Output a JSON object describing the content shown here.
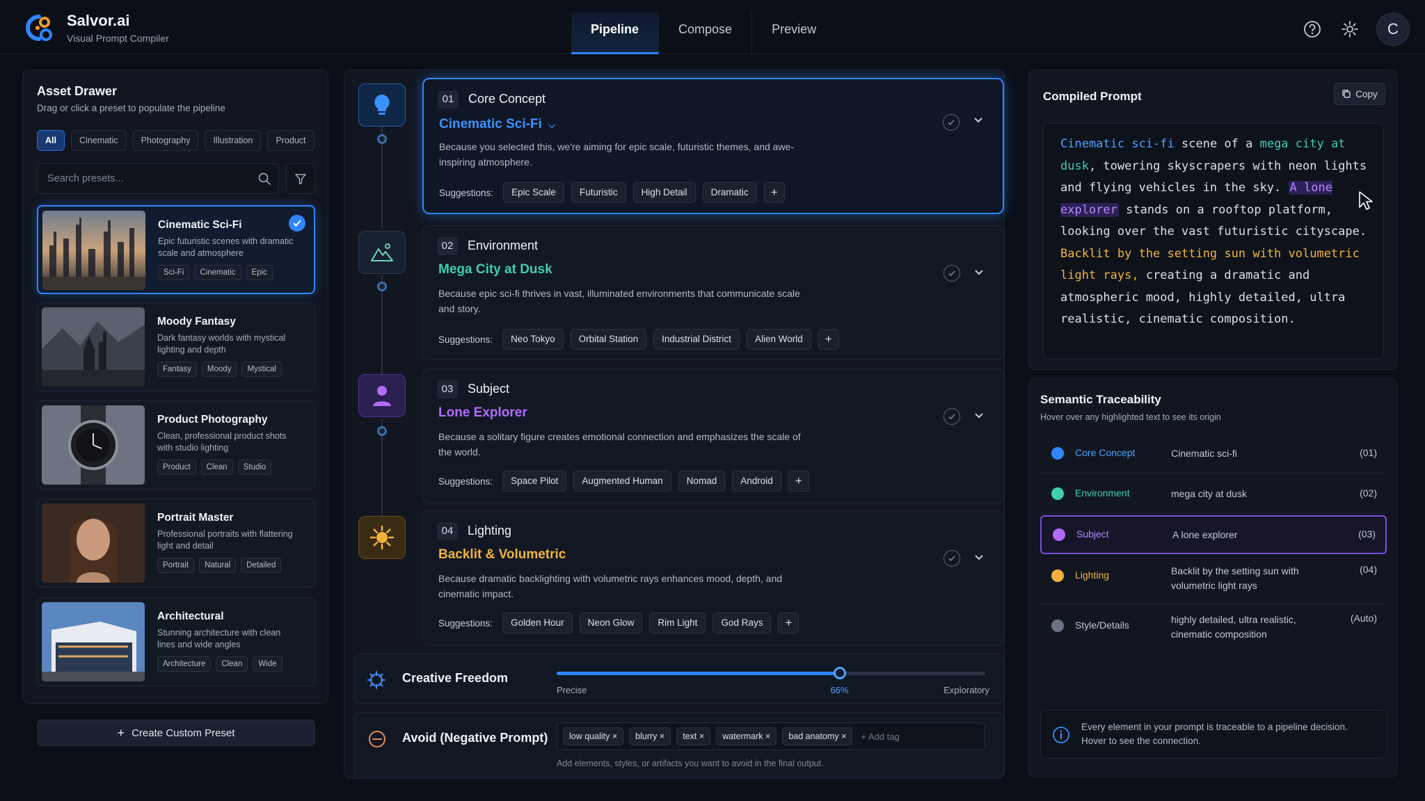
{
  "app": {
    "name": "Salvor.ai",
    "subtitle": "Visual Prompt Compiler",
    "avatar_initial": "C"
  },
  "nav": {
    "tabs": [
      {
        "label": "Pipeline",
        "active": true
      },
      {
        "label": "Compose"
      },
      {
        "label": "Preview"
      }
    ]
  },
  "header_icons": [
    "help-icon",
    "gear-icon"
  ],
  "drawer": {
    "title": "Asset Drawer",
    "subtitle": "Drag or click a preset to populate the pipeline",
    "filters": [
      "All",
      "Cinematic",
      "Photography",
      "Illustration",
      "Product"
    ],
    "search_placeholder": "Search presets...",
    "presets": [
      {
        "name": "Cinematic Sci-Fi",
        "desc": "Epic futuristic scenes with dramatic scale and atmosphere",
        "tags": [
          "Sci-Fi",
          "Cinematic",
          "Epic"
        ],
        "selected": true
      },
      {
        "name": "Moody Fantasy",
        "desc": "Dark fantasy worlds with mystical lighting and depth",
        "tags": [
          "Fantasy",
          "Moody",
          "Mystical"
        ]
      },
      {
        "name": "Product Photography",
        "desc": "Clean, professional product shots with studio lighting",
        "tags": [
          "Product",
          "Clean",
          "Studio"
        ]
      },
      {
        "name": "Portrait Master",
        "desc": "Professional portraits with flattering light and detail",
        "tags": [
          "Portrait",
          "Natural",
          "Detailed"
        ]
      },
      {
        "name": "Architectural",
        "desc": "Stunning architecture with clean lines and wide angles",
        "tags": [
          "Architecture",
          "Clean",
          "Wide"
        ]
      }
    ],
    "create_label": "Create Custom Preset"
  },
  "pipeline": {
    "suggestions_label": "Suggestions:",
    "steps": [
      {
        "num": "01",
        "label": "Core Concept",
        "value": "Cinematic Sci-Fi",
        "color": "#2f86ff",
        "because": "Because you selected this, we're aiming for epic scale, futuristic themes, and awe-inspiring atmosphere.",
        "suggestions": [
          "Epic Scale",
          "Futuristic",
          "High Detail",
          "Dramatic"
        ],
        "icon": "lightbulb-icon"
      },
      {
        "num": "02",
        "label": "Environment",
        "value": "Mega City at Dusk",
        "color": "#3fcfae",
        "because": "Because epic sci-fi thrives in vast, illuminated environments that communicate scale and story.",
        "suggestions": [
          "Neo Tokyo",
          "Orbital Station",
          "Industrial District",
          "Alien World"
        ],
        "icon": "mountain-icon"
      },
      {
        "num": "03",
        "label": "Subject",
        "value": "Lone Explorer",
        "color": "#b26bff",
        "because": "Because a solitary figure creates emotional connection and emphasizes the scale of the world.",
        "suggestions": [
          "Space Pilot",
          "Augmented Human",
          "Nomad",
          "Android"
        ],
        "icon": "person-icon"
      },
      {
        "num": "04",
        "label": "Lighting",
        "value": "Backlit & Volumetric",
        "color": "#f2b33d",
        "because": "Because dramatic backlighting with volumetric rays enhances mood, depth, and cinematic impact.",
        "suggestions": [
          "Golden Hour",
          "Neon Glow",
          "Rim Light",
          "God Rays"
        ],
        "icon": "sun-icon"
      }
    ],
    "creative_freedom": {
      "label": "Creative Freedom",
      "min_label": "Precise",
      "max_label": "Exploratory",
      "value": 0.66,
      "value_label": "66%"
    },
    "negative": {
      "label": "Avoid (Negative Prompt)",
      "tags": [
        "low quality",
        "blurry",
        "text",
        "watermark",
        "bad anatomy"
      ],
      "add_placeholder": "+ Add tag",
      "hint": "Add elements, styles, or artifacts you want to avoid in the final output."
    }
  },
  "compiled": {
    "title": "Compiled Prompt",
    "copy_label": "Copy",
    "segments": {
      "s1": "Cinematic sci-fi",
      "s2": " scene of a ",
      "s3": "mega city at dusk",
      "s4": ", towering skyscrapers with neon lights and flying vehicles in the sky. ",
      "s5": "A lone explorer",
      "s6": " stands on a rooftop platform, looking over the vast futuristic cityscape. ",
      "s7": "Backlit by the setting sun with volumetric light rays,",
      "s8": " creating a dramatic and atmospheric mood, highly detailed, ultra realistic, cinematic composition."
    }
  },
  "trace": {
    "title": "Semantic Traceability",
    "subtitle": "Hover over any highlighted text to see its origin",
    "rows": [
      {
        "cat": "Core Concept",
        "val": "Cinematic sci-fi",
        "id": "(01)",
        "color": "#2f86ff"
      },
      {
        "cat": "Environment",
        "val": "mega city at dusk",
        "id": "(02)",
        "color": "#3fcfae"
      },
      {
        "cat": "Subject",
        "val": "A lone explorer",
        "id": "(03)",
        "color": "#b26bff"
      },
      {
        "cat": "Lighting",
        "val": "Backlit by the setting sun with volumetric light rays",
        "id": "(04)",
        "color": "#f2b33d"
      },
      {
        "cat": "Style/Details",
        "val": "highly detailed, ultra realistic, cinematic composition",
        "id": "(Auto)",
        "color": "#6b7282"
      }
    ],
    "info": "Every element in your prompt is traceable to a pipeline decision. Hover to see the connection."
  }
}
